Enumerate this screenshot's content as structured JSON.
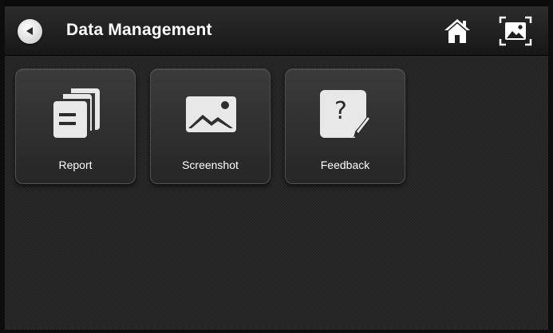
{
  "header": {
    "title": "Data Management",
    "back_icon": "back-arrow-icon",
    "home_icon": "home-icon",
    "screenshot_icon": "screenshot-icon"
  },
  "tiles": [
    {
      "label": "Report",
      "icon": "report-document-icon"
    },
    {
      "label": "Screenshot",
      "icon": "image-gallery-icon"
    },
    {
      "label": "Feedback",
      "icon": "feedback-question-icon"
    }
  ],
  "colors": {
    "background": "#2a2a2a",
    "header": "#1e1e1e",
    "tile": "#313131",
    "icon": "#e6e6e6",
    "text": "#ffffff"
  }
}
